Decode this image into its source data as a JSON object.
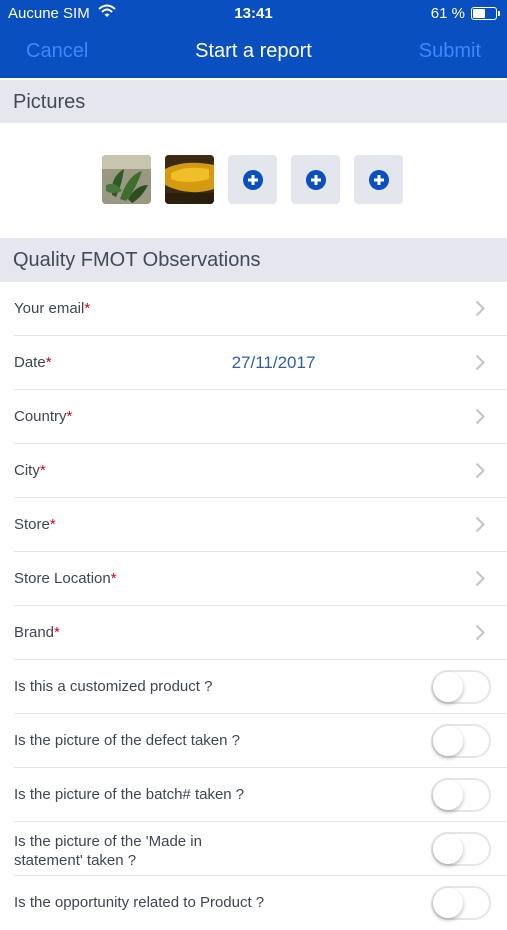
{
  "status_bar": {
    "carrier": "Aucune SIM",
    "time": "13:41",
    "battery": "61 %",
    "battery_level": 0.61
  },
  "nav": {
    "cancel": "Cancel",
    "title": "Start a report",
    "submit": "Submit"
  },
  "pictures_section": {
    "title": "Pictures"
  },
  "quality_section": {
    "title": "Quality FMOT Observations"
  },
  "fields": [
    {
      "label": "Your email",
      "required": "*",
      "value": ""
    },
    {
      "label": "Date",
      "required": "*",
      "value": "27/11/2017"
    },
    {
      "label": "Country",
      "required": "*",
      "value": ""
    },
    {
      "label": "City",
      "required": "*",
      "value": ""
    },
    {
      "label": "Store",
      "required": "*",
      "value": ""
    },
    {
      "label": "Store Location",
      "required": "*",
      "value": ""
    },
    {
      "label": "Brand",
      "required": "*",
      "value": ""
    }
  ],
  "toggles": [
    {
      "label": "Is this a customized product ?",
      "on": false
    },
    {
      "label": "Is the picture of the defect taken ?",
      "on": false
    },
    {
      "label": "Is the picture of the batch# taken ?",
      "on": false
    },
    {
      "label_line1": "Is the picture of the 'Made in",
      "label_line2": "statement' taken ?",
      "on": false
    },
    {
      "label": "Is the opportunity related to Product ?",
      "on": false
    }
  ]
}
